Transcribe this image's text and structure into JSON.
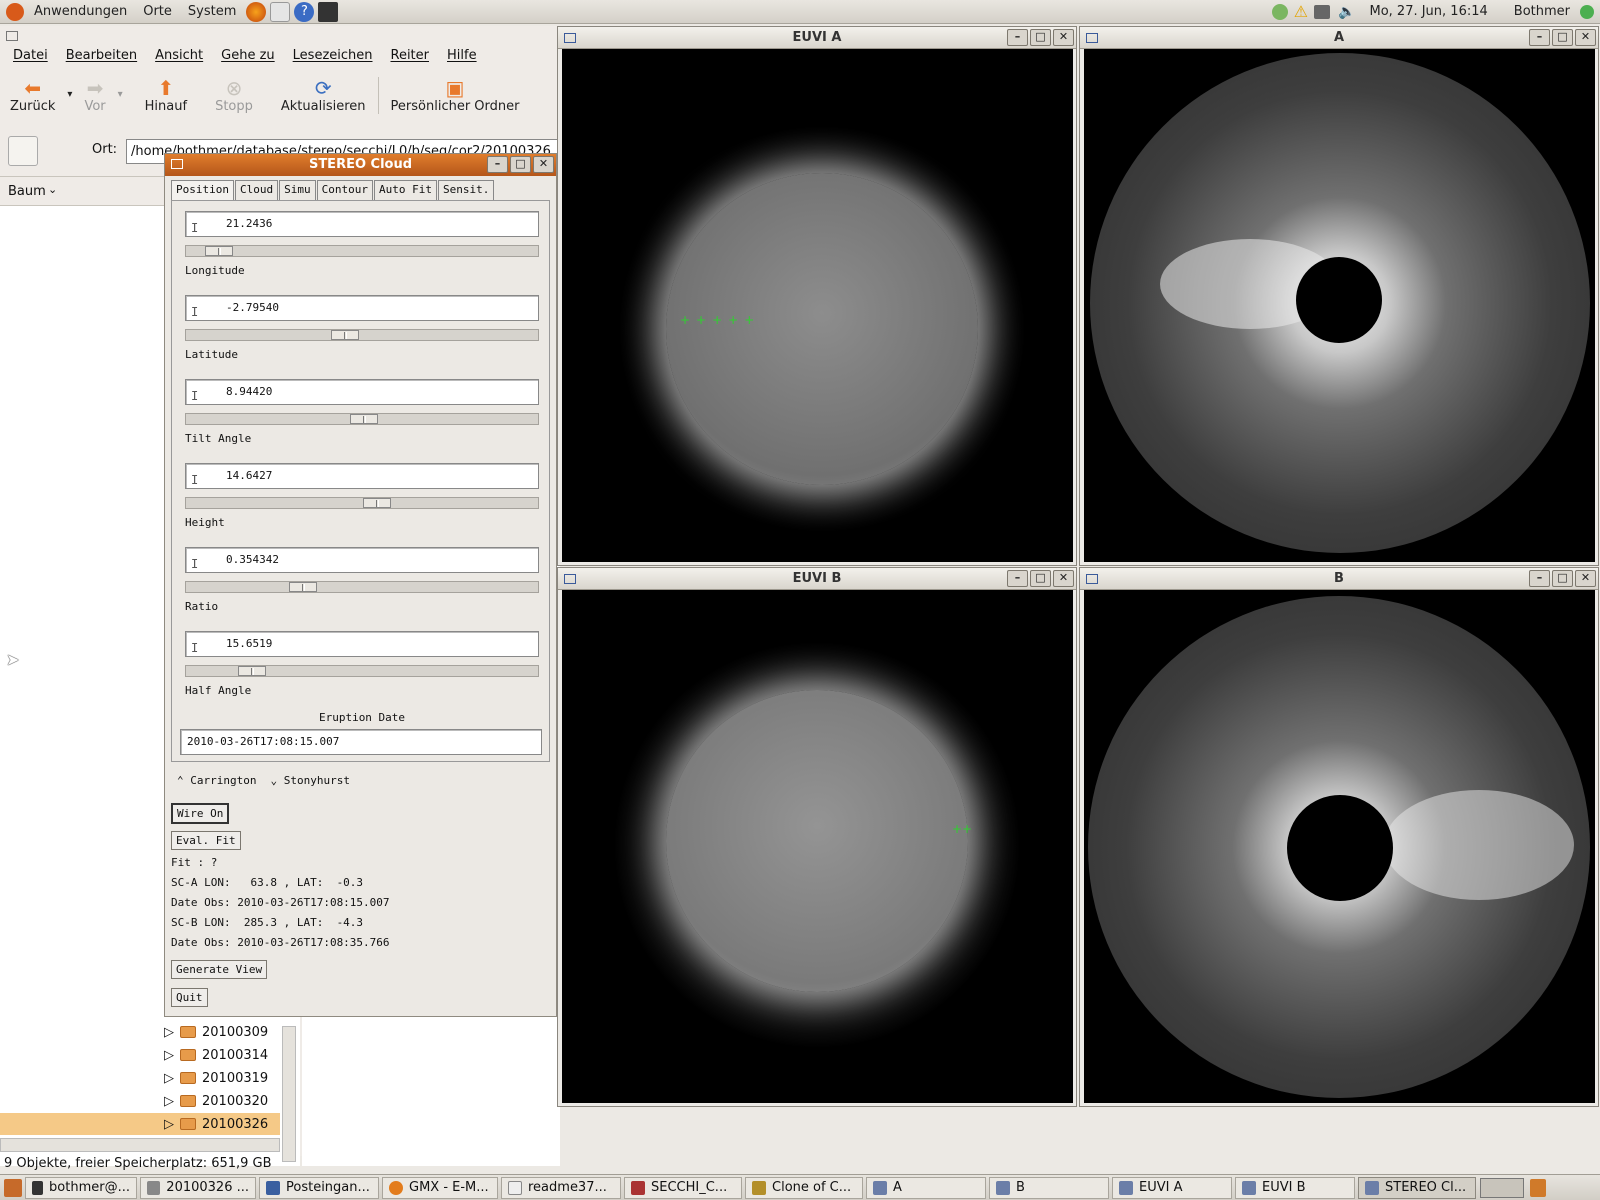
{
  "top_panel": {
    "menus": [
      "Anwendungen",
      "Orte",
      "System"
    ],
    "clock": "Mo, 27. Jun, 16:14",
    "user": "Bothmer"
  },
  "nautilus": {
    "menus": [
      "Datei",
      "Bearbeiten",
      "Ansicht",
      "Gehe zu",
      "Lesezeichen",
      "Reiter",
      "Hilfe"
    ],
    "toolbar": {
      "back": "Zurück",
      "forward": "Vor",
      "up": "Hinauf",
      "stop": "Stopp",
      "reload": "Aktualisieren",
      "home": "Persönlicher Ordner"
    },
    "location_label": "Ort:",
    "location_value": "/home/bothmer/database/stereo/secchi/L0/b/seq/cor2/20100326",
    "sidebar_mode": "Baum",
    "tree": [
      "20100309",
      "20100314",
      "20100319",
      "20100320",
      "20100326"
    ],
    "statusbar": "9 Objekte, freier Speicherplatz: 651,9 GB"
  },
  "cloud": {
    "title": "STEREO Cloud",
    "tabs": [
      "Position",
      "Cloud",
      "Simu",
      "Contour",
      "Auto Fit",
      "Sensit."
    ],
    "params": [
      {
        "label": "Longitude",
        "value": "21.2436",
        "pos": 0.06
      },
      {
        "label": "Latitude",
        "value": "-2.79540",
        "pos": 0.45
      },
      {
        "label": "Tilt Angle",
        "value": "8.94420",
        "pos": 0.51
      },
      {
        "label": "Height",
        "value": "14.6427",
        "pos": 0.55
      },
      {
        "label": "Ratio",
        "value": "0.354342",
        "pos": 0.32
      },
      {
        "label": "Half Angle",
        "value": "15.6519",
        "pos": 0.16
      }
    ],
    "eruption_label": "Eruption Date",
    "eruption_value": "2010-03-26T17:08:15.007",
    "coord_options": [
      "Carrington",
      "Stonyhurst"
    ],
    "wire_button": "Wire On",
    "eval_button": "Eval. Fit",
    "fit_text": "Fit : ?",
    "sca_text": "SC-A LON:   63.8 , LAT:  -0.3",
    "sca_date": "Date Obs: 2010-03-26T17:08:15.007",
    "scb_text": "SC-B LON:  285.3 , LAT:  -4.3",
    "scb_date": "Date Obs: 2010-03-26T17:08:35.766",
    "generate_button": "Generate View",
    "quit_button": "Quit"
  },
  "windows": {
    "euvi_a": "EUVI A",
    "cor_a": "A",
    "euvi_b": "EUVI B",
    "cor_b": "B"
  },
  "taskbar": [
    "bothmer@...",
    "20100326 ...",
    "Posteingan...",
    "GMX - E-M...",
    "readme37...",
    "SECCHI_C...",
    "Clone of C...",
    "A",
    "B",
    "EUVI A",
    "EUVI B",
    "STEREO Cl..."
  ]
}
